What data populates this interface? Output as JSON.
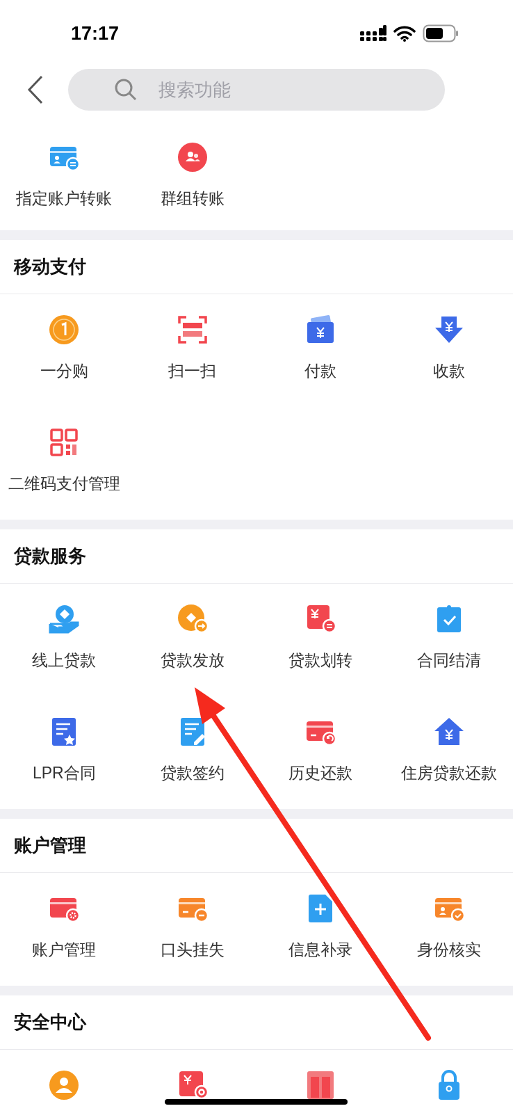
{
  "status_bar": {
    "time": "17:17"
  },
  "search": {
    "placeholder": "搜索功能"
  },
  "sections": [
    {
      "items": [
        {
          "label": "指定账户转账"
        },
        {
          "label": "群组转账"
        }
      ]
    },
    {
      "title": "移动支付",
      "items": [
        {
          "label": "一分购"
        },
        {
          "label": "扫一扫"
        },
        {
          "label": "付款"
        },
        {
          "label": "收款"
        },
        {
          "label": "二维码支付管理"
        }
      ]
    },
    {
      "title": "贷款服务",
      "items": [
        {
          "label": "线上贷款"
        },
        {
          "label": "贷款发放"
        },
        {
          "label": "贷款划转"
        },
        {
          "label": "合同结清"
        },
        {
          "label": "LPR合同"
        },
        {
          "label": "贷款签约"
        },
        {
          "label": "历史还款"
        },
        {
          "label": "住房贷款还款"
        }
      ]
    },
    {
      "title": "账户管理",
      "items": [
        {
          "label": "账户管理"
        },
        {
          "label": "口头挂失"
        },
        {
          "label": "信息补录"
        },
        {
          "label": "身份核实"
        }
      ]
    },
    {
      "title": "安全中心"
    }
  ]
}
